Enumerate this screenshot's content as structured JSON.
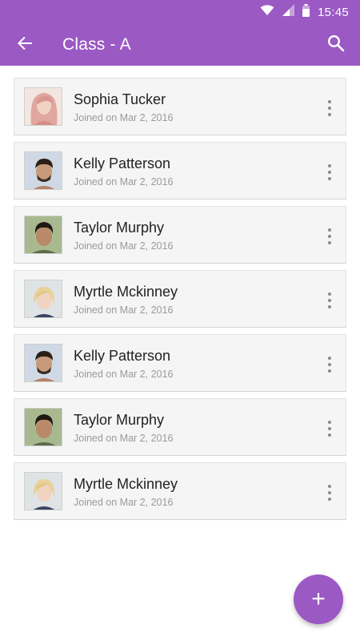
{
  "colors": {
    "primary": "#9b59c4",
    "card_bg": "#f5f5f5"
  },
  "status_bar": {
    "time": "15:45",
    "icons": [
      "wifi-icon",
      "signal-icon",
      "battery-icon"
    ]
  },
  "app_bar": {
    "title": "Class - A",
    "back_icon": "arrow-left-icon",
    "search_icon": "search-icon"
  },
  "students": [
    {
      "name": "Sophia Tucker",
      "joined": "Joined on Mar 2, 2016",
      "avatar": "woman-pink-hair"
    },
    {
      "name": "Kelly Patterson",
      "joined": "Joined on Mar 2, 2016",
      "avatar": "man-beard"
    },
    {
      "name": "Taylor Murphy",
      "joined": "Joined on Mar 2, 2016",
      "avatar": "man-young"
    },
    {
      "name": "Myrtle Mckinney",
      "joined": "Joined on Mar 2, 2016",
      "avatar": "woman-blonde"
    },
    {
      "name": "Kelly Patterson",
      "joined": "Joined on Mar 2, 2016",
      "avatar": "man-beard"
    },
    {
      "name": "Taylor Murphy",
      "joined": "Joined on Mar 2, 2016",
      "avatar": "man-young"
    },
    {
      "name": "Myrtle Mckinney",
      "joined": "Joined on Mar 2, 2016",
      "avatar": "woman-blonde"
    }
  ],
  "fab": {
    "label": "+",
    "icon": "plus-icon"
  }
}
